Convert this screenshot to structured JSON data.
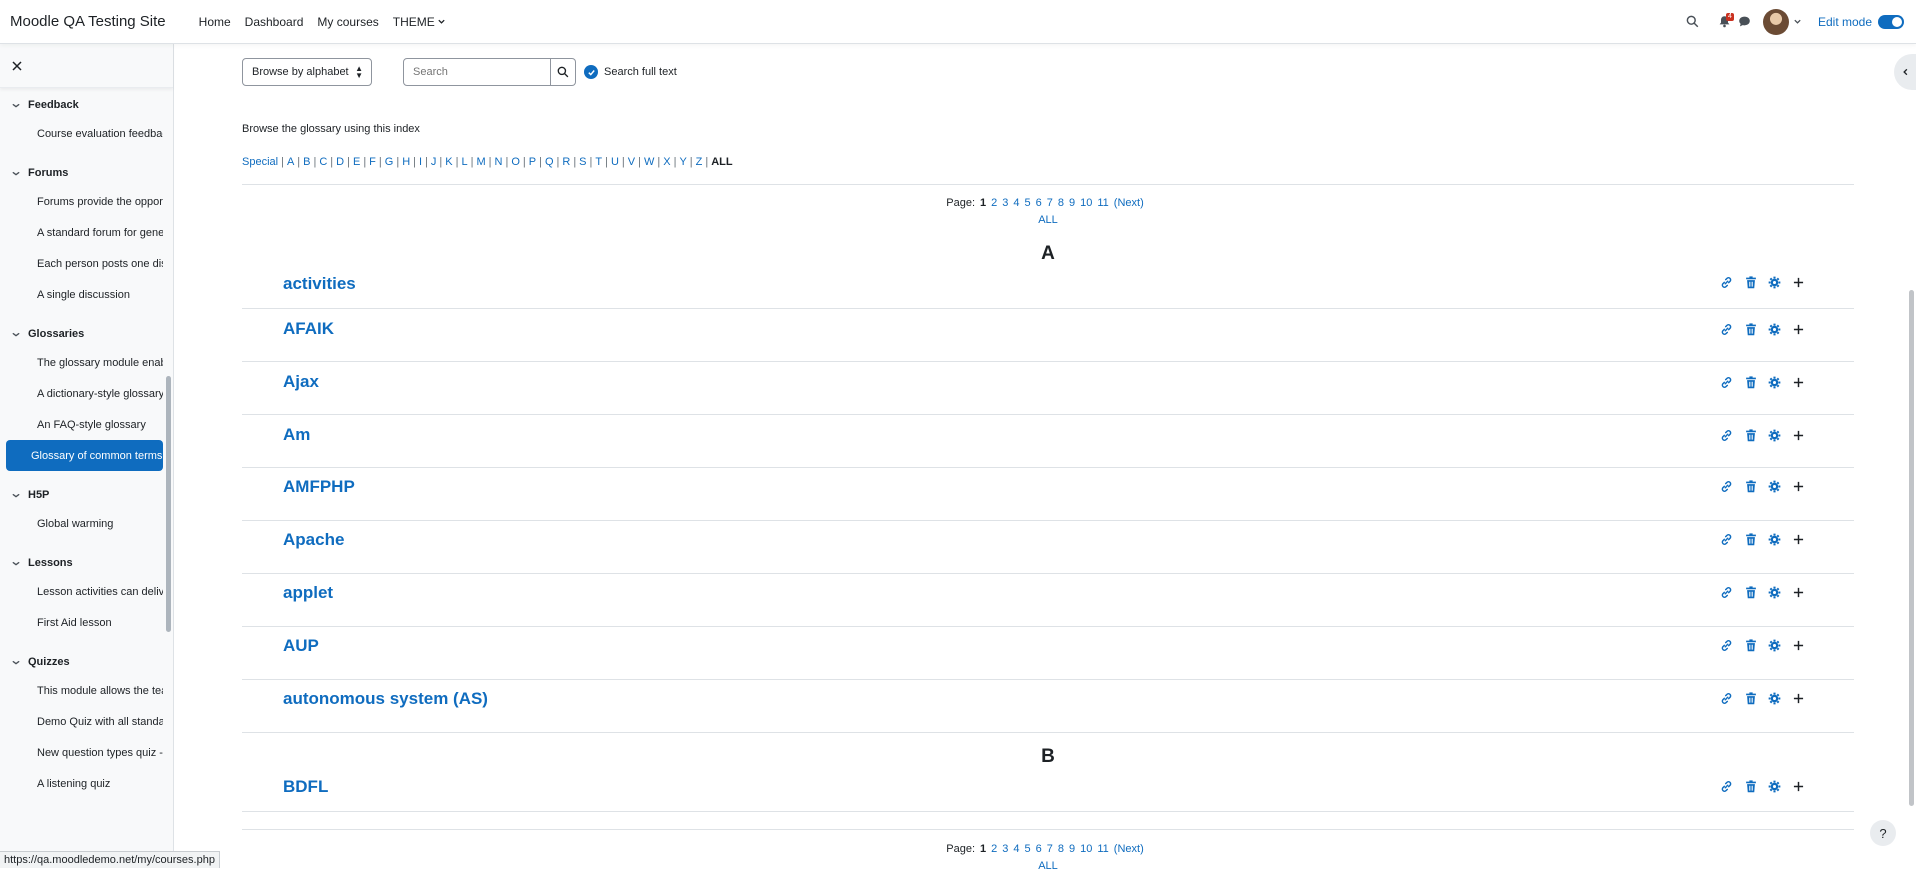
{
  "navbar": {
    "brand": "Moodle QA Testing Site",
    "links": [
      "Home",
      "Dashboard",
      "My courses",
      "THEME"
    ],
    "notification_count": "4",
    "edit_mode_label": "Edit mode"
  },
  "drawer": {
    "sections": [
      {
        "title": "Feedback",
        "items": [
          "Course evaluation feedback"
        ]
      },
      {
        "title": "Forums",
        "items": [
          "Forums provide the opport...",
          "A standard forum for gene...",
          "Each person posts one disc...",
          "A single discussion"
        ]
      },
      {
        "title": "Glossaries",
        "items": [
          "The glossary module enabl...",
          "A dictionary-style glossary",
          "An FAQ-style glossary",
          "Glossary of common terms"
        ],
        "active_index": 3
      },
      {
        "title": "H5P",
        "items": [
          "Global warming"
        ]
      },
      {
        "title": "Lessons",
        "items": [
          "Lesson activities can delive...",
          "First Aid lesson"
        ]
      },
      {
        "title": "Quizzes",
        "items": [
          "This module allows the tea...",
          "Demo Quiz with all standar...",
          "New question types quiz - ...",
          "A listening quiz"
        ]
      }
    ]
  },
  "controls": {
    "browse_select": "Browse by alphabet",
    "search_placeholder": "Search",
    "full_text_label": "Search full text"
  },
  "index": {
    "intro": "Browse the glossary using this index",
    "letters": [
      "Special",
      "A",
      "B",
      "C",
      "D",
      "E",
      "F",
      "G",
      "H",
      "I",
      "J",
      "K",
      "L",
      "M",
      "N",
      "O",
      "P",
      "Q",
      "R",
      "S",
      "T",
      "U",
      "V",
      "W",
      "X",
      "Y",
      "Z"
    ],
    "all_label": "ALL"
  },
  "paging": {
    "label": "Page:",
    "current": "1",
    "pages": [
      "2",
      "3",
      "4",
      "5",
      "6",
      "7",
      "8",
      "9",
      "10",
      "11"
    ],
    "next": "(Next)",
    "all": "ALL"
  },
  "groups": [
    {
      "letter": "A",
      "entries": [
        "activities",
        "AFAIK",
        "Ajax",
        "Am",
        "AMFPHP",
        "Apache",
        "applet",
        "AUP",
        "autonomous system (AS)"
      ]
    },
    {
      "letter": "B",
      "entries": [
        "BDFL"
      ]
    }
  ],
  "help_label": "?",
  "status_url": "https://qa.moodledemo.net/my/courses.php"
}
